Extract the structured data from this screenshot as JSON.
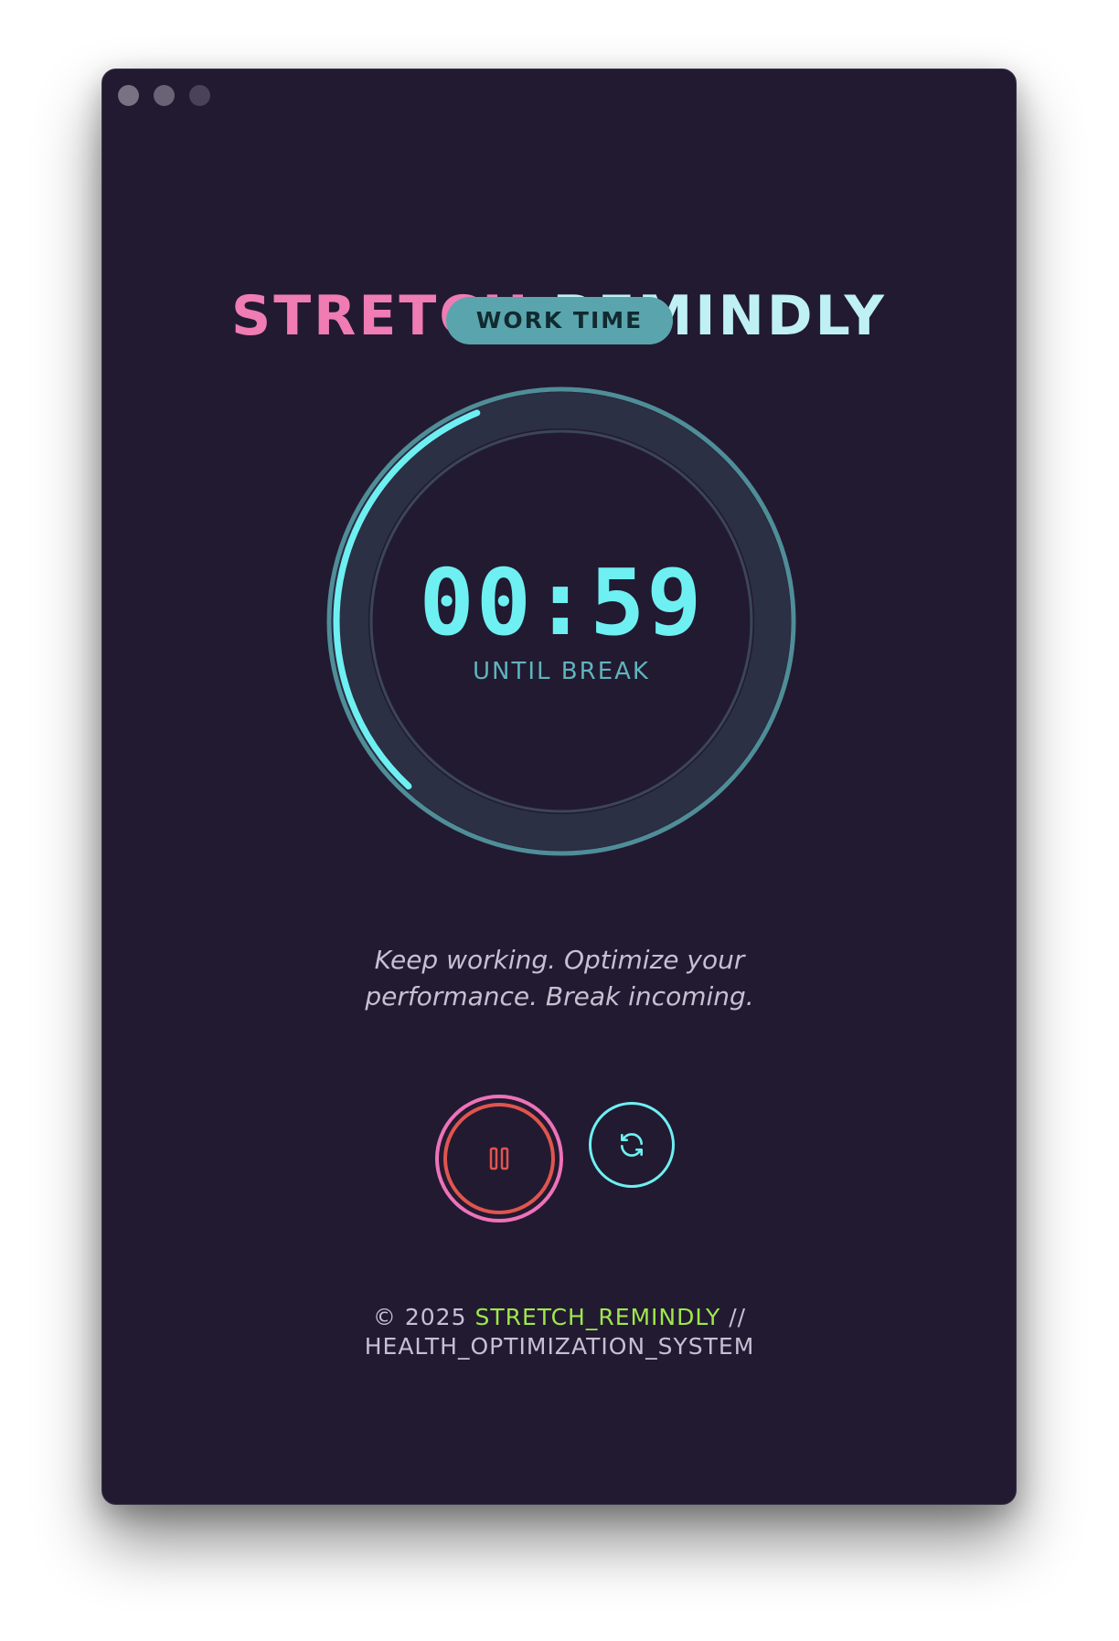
{
  "app": {
    "title_part1": "STRETCH",
    "title_part2": "REMINDLY",
    "mode_badge": "WORK TIME"
  },
  "timer": {
    "time": "00:59",
    "label": "UNTIL BREAK",
    "progress_fraction": 0.32
  },
  "message": {
    "line1": "Keep working. Optimize your",
    "line2": "performance. Break incoming."
  },
  "controls": {
    "pause_icon": "pause-icon",
    "reset_icon": "refresh-icon"
  },
  "footer": {
    "copyright": "© 2025",
    "brand": "STRETCH_REMINDLY",
    "separator": "//",
    "system": "HEALTH_OPTIMIZATION_SYSTEM"
  },
  "colors": {
    "background": "#221a31",
    "accent_cyan": "#6ef0f2",
    "accent_pink": "#f07cb4",
    "accent_green": "#9ee84a",
    "pause_red": "#e0554e"
  }
}
